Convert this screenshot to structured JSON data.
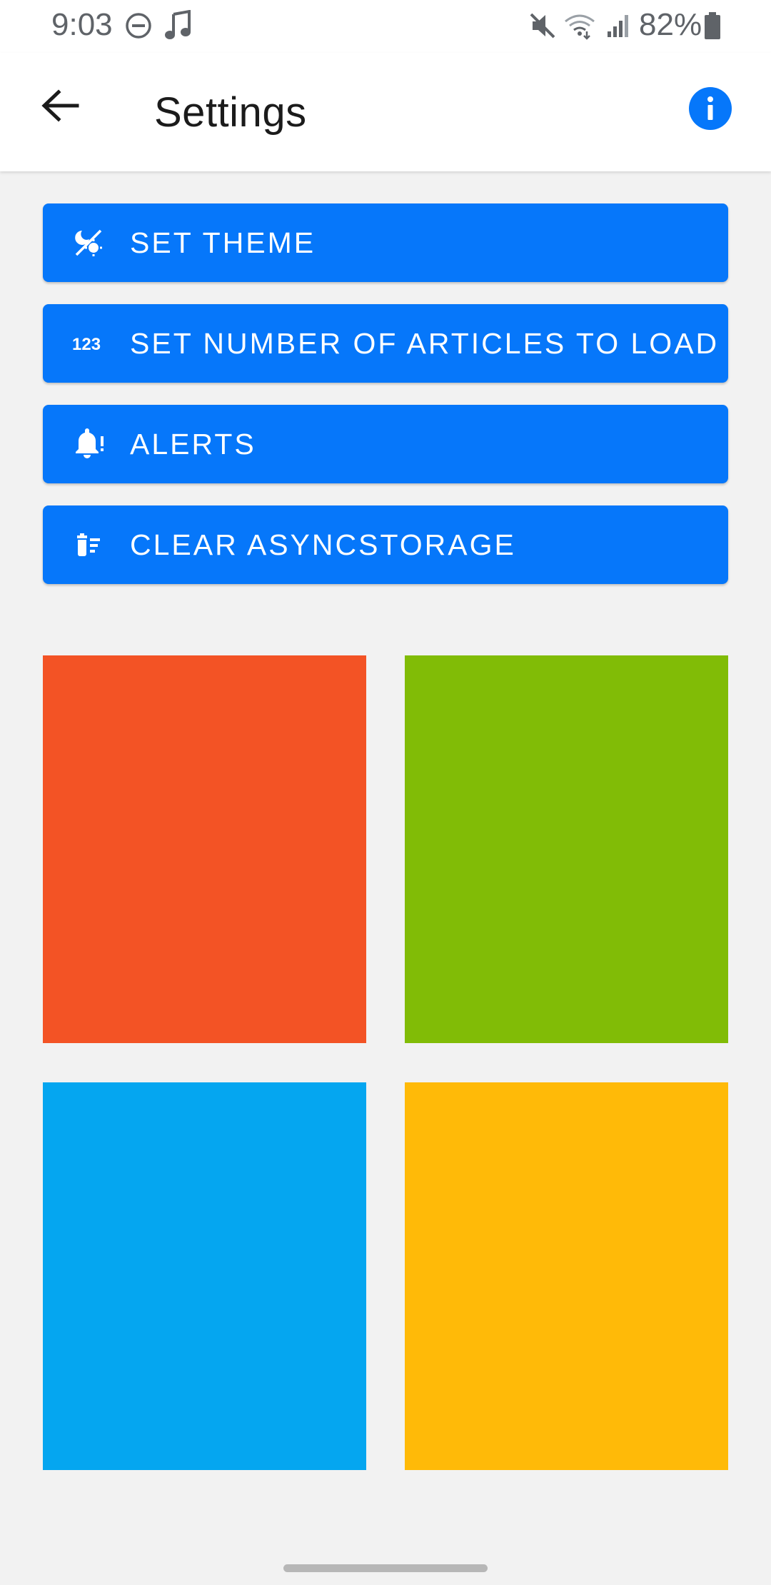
{
  "status_bar": {
    "time": "9:03",
    "battery": "82%",
    "icons": [
      "do-not-disturb-icon",
      "music-note-icon",
      "mute-icon",
      "wifi-icon",
      "signal-icon",
      "battery-icon"
    ]
  },
  "app_bar": {
    "title": "Settings",
    "back_icon": "arrow-back-icon",
    "info_icon": "info-icon"
  },
  "settings": {
    "buttons": [
      {
        "label": "SET THEME",
        "icon": "theme-icon"
      },
      {
        "label": "SET NUMBER OF ARTICLES TO LOAD",
        "icon": "numbers-123-icon"
      },
      {
        "label": "ALERTS",
        "icon": "bell-alert-icon"
      },
      {
        "label": "CLEAR ASYNCSTORAGE",
        "icon": "delete-sweep-icon"
      }
    ]
  },
  "tiles": [
    {
      "name": "red-tile",
      "color": "#f35325"
    },
    {
      "name": "green-tile",
      "color": "#81bc06"
    },
    {
      "name": "blue-tile",
      "color": "#05a6f0"
    },
    {
      "name": "yellow-tile",
      "color": "#ffba08"
    }
  ],
  "colors": {
    "accent": "#0677fa",
    "background": "#f2f2f2",
    "app_bar": "#ffffff"
  }
}
